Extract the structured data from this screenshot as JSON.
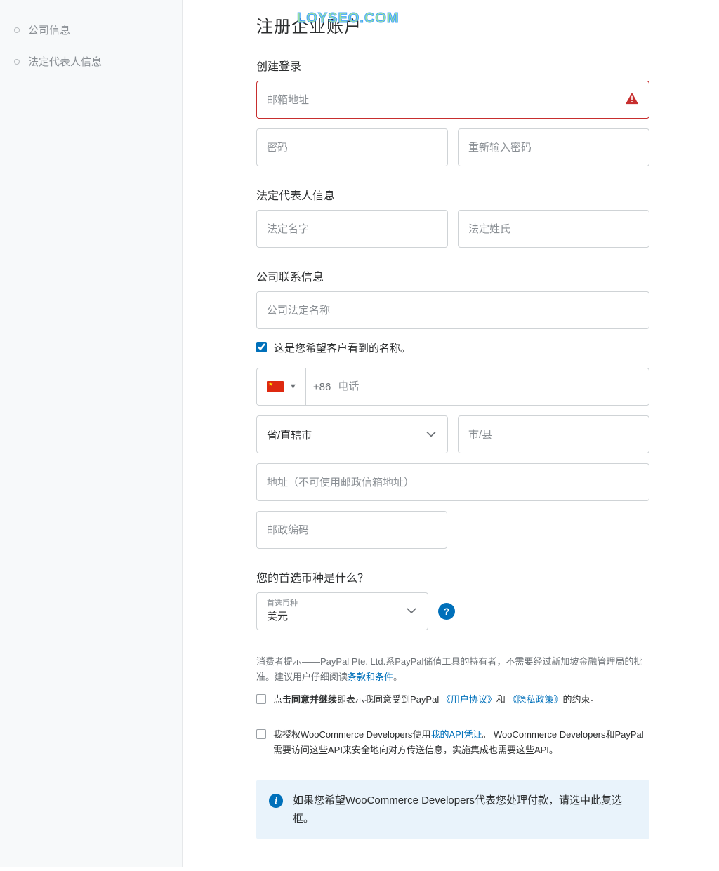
{
  "watermark": "LOYSEO.COM",
  "sidebar": {
    "items": [
      {
        "label": "公司信息"
      },
      {
        "label": "法定代表人信息"
      }
    ]
  },
  "page": {
    "title": "注册企业账户"
  },
  "sections": {
    "login": {
      "heading": "创建登录",
      "email_placeholder": "邮箱地址",
      "password_placeholder": "密码",
      "password_confirm_placeholder": "重新输入密码"
    },
    "legal_rep": {
      "heading": "法定代表人信息",
      "first_name_placeholder": "法定名字",
      "last_name_placeholder": "法定姓氏"
    },
    "company": {
      "heading": "公司联系信息",
      "legal_name_placeholder": "公司法定名称",
      "display_name_note": "这是您希望客户看到的名称。",
      "display_name_checked": true,
      "dial_code": "+86",
      "phone_placeholder": "电话",
      "province_placeholder": "省/直辖市",
      "city_placeholder": "市/县",
      "address_placeholder": "地址（不可使用邮政信箱地址）",
      "postal_placeholder": "邮政编码"
    },
    "currency": {
      "heading": "您的首选币种是什么？",
      "field_label": "首选币种",
      "value": "美元"
    }
  },
  "legal": {
    "disclaimer_prefix": "消费者提示——PayPal Pte. Ltd.系PayPal储值工具的持有者，不需要经过新加坡金融管理局的批准。建议用户仔细阅读",
    "terms_link": "条款和条件",
    "period": "。",
    "agree_prefix": "点击",
    "agree_bold": "同意并继续",
    "agree_mid": "即表示我同意受到PayPal",
    "user_agreement": "《用户协议》",
    "and": "和",
    "privacy_policy": "《隐私政策》",
    "agree_suffix": "的约束。",
    "api_prefix": "我授权WooCommerce Developers使用",
    "api_link": "我的API凭证",
    "api_suffix": "。 WooCommerce Developers和PayPal需要访问这些API来安全地向对方传送信息，实施集成也需要这些API。"
  },
  "banner": {
    "text": "如果您希望WooCommerce Developers代表您处理付款，请选中此复选框。"
  }
}
